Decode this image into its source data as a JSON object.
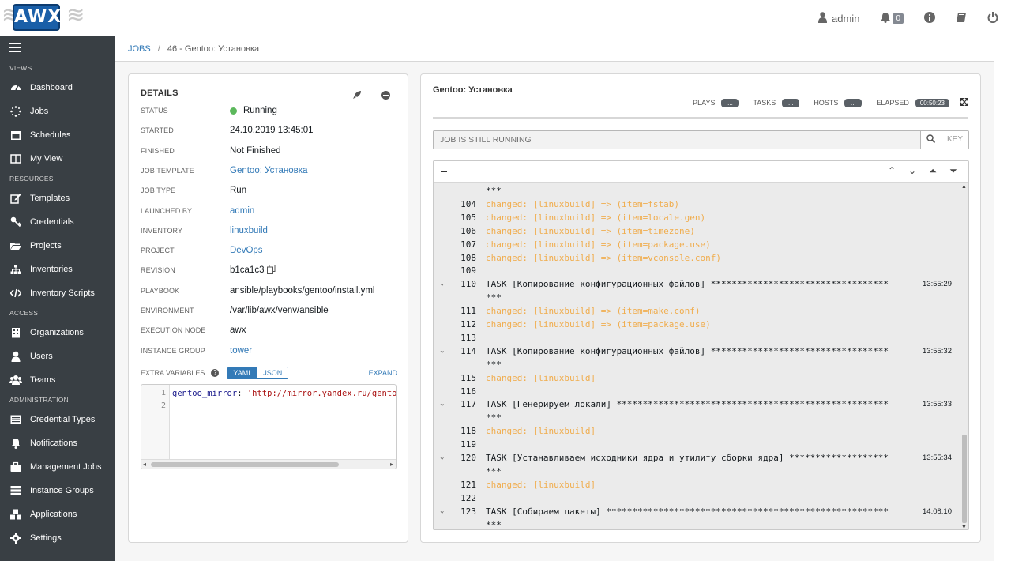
{
  "topbar": {
    "logo_text": "AWX",
    "user": "admin",
    "notifications_count": "0"
  },
  "sidebar": {
    "sections": [
      {
        "label": "VIEWS",
        "items": [
          {
            "label": "Dashboard",
            "icon": "dashboard-icon"
          },
          {
            "label": "Jobs",
            "icon": "jobs-spinner-icon"
          },
          {
            "label": "Schedules",
            "icon": "calendar-icon"
          },
          {
            "label": "My View",
            "icon": "columns-icon"
          }
        ]
      },
      {
        "label": "RESOURCES",
        "items": [
          {
            "label": "Templates",
            "icon": "pencil-square-icon"
          },
          {
            "label": "Credentials",
            "icon": "key-icon"
          },
          {
            "label": "Projects",
            "icon": "folder-open-icon"
          },
          {
            "label": "Inventories",
            "icon": "sitemap-icon"
          },
          {
            "label": "Inventory Scripts",
            "icon": "code-icon"
          }
        ]
      },
      {
        "label": "ACCESS",
        "items": [
          {
            "label": "Organizations",
            "icon": "building-icon"
          },
          {
            "label": "Users",
            "icon": "user-icon"
          },
          {
            "label": "Teams",
            "icon": "users-icon"
          }
        ]
      },
      {
        "label": "ADMINISTRATION",
        "items": [
          {
            "label": "Credential Types",
            "icon": "list-alt-icon"
          },
          {
            "label": "Notifications",
            "icon": "bell-icon"
          },
          {
            "label": "Management Jobs",
            "icon": "briefcase-icon"
          },
          {
            "label": "Instance Groups",
            "icon": "server-icon"
          },
          {
            "label": "Applications",
            "icon": "cubes-icon"
          },
          {
            "label": "Settings",
            "icon": "cog-icon"
          }
        ]
      }
    ]
  },
  "breadcrumb": {
    "root": "JOBS",
    "sep": "/",
    "current": "46 - Gentoo: Установка"
  },
  "details": {
    "title": "DETAILS",
    "rows": [
      {
        "label": "STATUS",
        "value": "Running"
      },
      {
        "label": "STARTED",
        "value": "24.10.2019 13:45:01"
      },
      {
        "label": "FINISHED",
        "value": "Not Finished"
      },
      {
        "label": "JOB TEMPLATE",
        "value": "Gentoo: Установка"
      },
      {
        "label": "JOB TYPE",
        "value": "Run"
      },
      {
        "label": "LAUNCHED BY",
        "value": "admin"
      },
      {
        "label": "INVENTORY",
        "value": "linuxbuild"
      },
      {
        "label": "PROJECT",
        "value": "DevOps"
      },
      {
        "label": "REVISION",
        "value": "b1ca1c3"
      },
      {
        "label": "PLAYBOOK",
        "value": "ansible/playbooks/gentoo/install.yml"
      },
      {
        "label": "ENVIRONMENT",
        "value": "/var/lib/awx/venv/ansible"
      },
      {
        "label": "EXECUTION NODE",
        "value": "awx"
      },
      {
        "label": "INSTANCE GROUP",
        "value": "tower"
      }
    ],
    "extra_vars": {
      "label": "EXTRA VARIABLES",
      "help": "?",
      "yaml": "YAML",
      "json": "JSON",
      "expand": "EXPAND",
      "line_numbers": [
        "1",
        "2"
      ],
      "code_key": "gentoo_mirror",
      "code_colon": ": ",
      "code_value": "'http://mirror.yandex.ru/gentoo"
    }
  },
  "output": {
    "title": "Gentoo: Установка",
    "plays_label": "PLAYS",
    "plays_value": "...",
    "tasks_label": "TASKS",
    "tasks_value": "...",
    "hosts_label": "HOSTS",
    "hosts_value": "...",
    "elapsed_label": "ELAPSED",
    "elapsed_value": "00:50:23",
    "search_placeholder": "JOB IS STILL RUNNING",
    "key_label": "KEY",
    "lines": [
      {
        "n": "",
        "text": "***",
        "type": "cont"
      },
      {
        "n": "104",
        "text": "changed: [linuxbuild] => (item=fstab)",
        "type": "changed"
      },
      {
        "n": "105",
        "text": "changed: [linuxbuild] => (item=locale.gen)",
        "type": "changed"
      },
      {
        "n": "106",
        "text": "changed: [linuxbuild] => (item=timezone)",
        "type": "changed"
      },
      {
        "n": "107",
        "text": "changed: [linuxbuild] => (item=package.use)",
        "type": "changed"
      },
      {
        "n": "108",
        "text": "changed: [linuxbuild] => (item=vconsole.conf)",
        "type": "changed"
      },
      {
        "n": "109",
        "text": "",
        "type": "blank"
      },
      {
        "n": "110",
        "text": "TASK [Копирование конфигурационных файлов] **********************************",
        "type": "task",
        "time": "13:55:29"
      },
      {
        "n": "",
        "text": "***",
        "type": "cont"
      },
      {
        "n": "111",
        "text": "changed: [linuxbuild] => (item=make.conf)",
        "type": "changed"
      },
      {
        "n": "112",
        "text": "changed: [linuxbuild] => (item=package.use)",
        "type": "changed"
      },
      {
        "n": "113",
        "text": "",
        "type": "blank"
      },
      {
        "n": "114",
        "text": "TASK [Копирование конфигурационных файлов] **********************************",
        "type": "task",
        "time": "13:55:32"
      },
      {
        "n": "",
        "text": "***",
        "type": "cont"
      },
      {
        "n": "115",
        "text": "changed: [linuxbuild]",
        "type": "changed"
      },
      {
        "n": "116",
        "text": "",
        "type": "blank"
      },
      {
        "n": "117",
        "text": "TASK [Генерируем локали] ****************************************************",
        "type": "task",
        "time": "13:55:33"
      },
      {
        "n": "",
        "text": "***",
        "type": "cont"
      },
      {
        "n": "118",
        "text": "changed: [linuxbuild]",
        "type": "changed"
      },
      {
        "n": "119",
        "text": "",
        "type": "blank"
      },
      {
        "n": "120",
        "text": "TASK [Устанавливаем исходники ядра и утилиту сборки ядра] *******************",
        "type": "task",
        "time": "13:55:34"
      },
      {
        "n": "",
        "text": "***",
        "type": "cont"
      },
      {
        "n": "121",
        "text": "changed: [linuxbuild]",
        "type": "changed"
      },
      {
        "n": "122",
        "text": "",
        "type": "blank"
      },
      {
        "n": "123",
        "text": "TASK [Собираем пакеты] ******************************************************",
        "type": "task",
        "time": "14:08:10"
      },
      {
        "n": "",
        "text": "***",
        "type": "cont"
      }
    ]
  },
  "colors": {
    "sidebar_bg": "#393f44",
    "link": "#337ab7",
    "changed": "#f0ad4e",
    "running": "#5cb85c"
  }
}
